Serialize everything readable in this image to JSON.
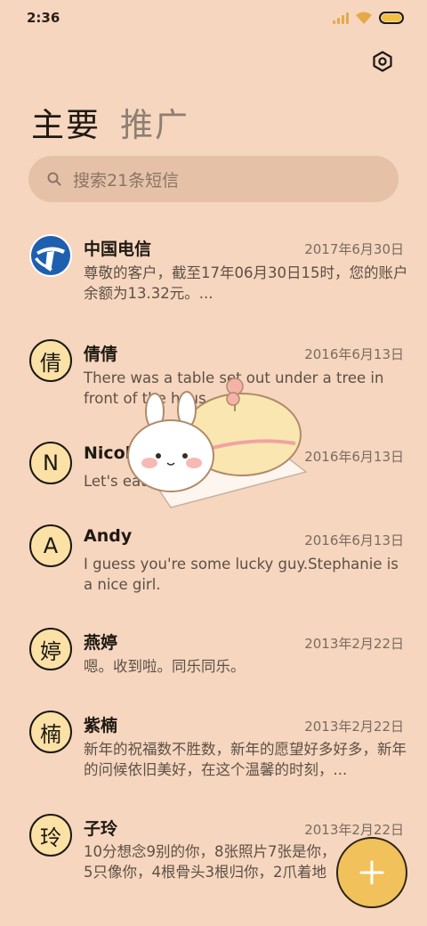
{
  "status_bar": {
    "time": "2:36"
  },
  "tabs": [
    {
      "label": "主要",
      "active": true
    },
    {
      "label": "推广",
      "active": false
    }
  ],
  "search": {
    "placeholder": "搜索21条短信"
  },
  "conversations": [
    {
      "avatar_text": "",
      "avatar_type": "logo",
      "name": "中国电信",
      "date": "2017年6月30日",
      "preview": "尊敬的客户，截至17年06月30日15时，您的账户余额为13.32元。..."
    },
    {
      "avatar_text": "倩",
      "avatar_type": "letter",
      "name": "倩倩",
      "date": "2016年6月13日",
      "preview": "There was a table set out under a tree in front of the hous"
    },
    {
      "avatar_text": "N",
      "avatar_type": "letter",
      "name": "Nicole",
      "date": "2016年6月13日",
      "preview": "Let's eat out,shall we?"
    },
    {
      "avatar_text": "A",
      "avatar_type": "letter",
      "name": "Andy",
      "date": "2016年6月13日",
      "preview": "I guess you're some lucky guy.Stephanie is a nice girl."
    },
    {
      "avatar_text": "婷",
      "avatar_type": "letter",
      "name": "燕婷",
      "date": "2013年2月22日",
      "preview": "嗯。收到啦。同乐同乐。"
    },
    {
      "avatar_text": "楠",
      "avatar_type": "letter",
      "name": "紫楠",
      "date": "2013年2月22日",
      "preview": "新年的祝福数不胜数，新年的愿望好多好多，新年的问候依旧美好，在这个温馨的时刻，..."
    },
    {
      "avatar_text": "玲",
      "avatar_type": "letter",
      "name": "子玲",
      "date": "2013年2月22日",
      "preview": "10分想念9别的你，8张照片7张是你，5只像你，4根骨头3根归你，2爪着地"
    }
  ],
  "colors": {
    "background": "#f6d6bf",
    "accent": "#f1c15b",
    "avatar_bg": "#fbe1a6"
  },
  "icons": {
    "settings": "settings-icon",
    "search": "search-icon",
    "compose": "plus-icon"
  }
}
